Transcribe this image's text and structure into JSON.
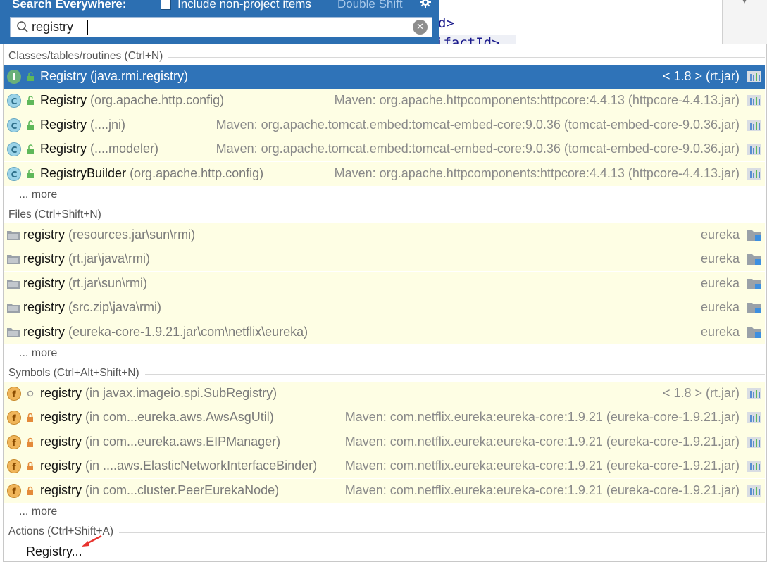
{
  "editor": {
    "code_line_1": "d>",
    "code_line_2": "ifactId>"
  },
  "header": {
    "title": "Search Everywhere:",
    "checkbox_label": "Include non-project items",
    "checkbox_shortcut": "Double Shift",
    "checkbox_checked": false,
    "settings_icon": "gear-icon"
  },
  "search": {
    "value": "registry",
    "search_icon": "search-icon",
    "clear_icon": "clear-icon"
  },
  "colors": {
    "header_bg": "#2c6fb2",
    "selected_row": "#2f73b8",
    "row_bg": "#fefee4"
  },
  "groups": {
    "classes": {
      "label": "Classes/tables/routines (Ctrl+N)",
      "items": [
        {
          "icon": "I",
          "name": "Registry",
          "context": "(java.rmi.registry)",
          "location": "< 1.8 > (rt.jar)"
        },
        {
          "icon": "C",
          "name": "Registry",
          "context": "(org.apache.http.config)",
          "location": "Maven: org.apache.httpcomponents:httpcore:4.4.13 (httpcore-4.4.13.jar)"
        },
        {
          "icon": "C",
          "name": "Registry",
          "context": "(....jni)",
          "location": "Maven: org.apache.tomcat.embed:tomcat-embed-core:9.0.36 (tomcat-embed-core-9.0.36.jar)"
        },
        {
          "icon": "C",
          "name": "Registry",
          "context": "(....modeler)",
          "location": "Maven: org.apache.tomcat.embed:tomcat-embed-core:9.0.36 (tomcat-embed-core-9.0.36.jar)"
        },
        {
          "icon": "C",
          "name": "RegistryBuilder",
          "context": "(org.apache.http.config)",
          "location": "Maven: org.apache.httpcomponents:httpcore:4.4.13 (httpcore-4.4.13.jar)"
        }
      ],
      "more": "... more"
    },
    "files": {
      "label": "Files (Ctrl+Shift+N)",
      "items": [
        {
          "name": "registry",
          "context": "(resources.jar\\sun\\rmi)",
          "location": "eureka"
        },
        {
          "name": "registry",
          "context": "(rt.jar\\java\\rmi)",
          "location": "eureka"
        },
        {
          "name": "registry",
          "context": "(rt.jar\\sun\\rmi)",
          "location": "eureka"
        },
        {
          "name": "registry",
          "context": "(src.zip\\java\\rmi)",
          "location": "eureka"
        },
        {
          "name": "registry",
          "context": "(eureka-core-1.9.21.jar\\com\\netflix\\eureka)",
          "location": "eureka"
        }
      ],
      "more": "... more"
    },
    "symbols": {
      "label": "Symbols (Ctrl+Alt+Shift+N)",
      "items": [
        {
          "icon": "f",
          "name": "registry",
          "context": "(in javax.imageio.spi.SubRegistry)",
          "location": "< 1.8 > (rt.jar)"
        },
        {
          "icon": "f",
          "name": "registry",
          "context": "(in com...eureka.aws.AwsAsgUtil)",
          "location": "Maven: com.netflix.eureka:eureka-core:1.9.21 (eureka-core-1.9.21.jar)"
        },
        {
          "icon": "f",
          "name": "registry",
          "context": "(in com...eureka.aws.EIPManager)",
          "location": "Maven: com.netflix.eureka:eureka-core:1.9.21 (eureka-core-1.9.21.jar)"
        },
        {
          "icon": "f",
          "name": "registry",
          "context": "(in ....aws.ElasticNetworkInterfaceBinder)",
          "location": "Maven: com.netflix.eureka:eureka-core:1.9.21 (eureka-core-1.9.21.jar)"
        },
        {
          "icon": "f",
          "name": "registry",
          "context": "(in com...cluster.PeerEurekaNode)",
          "location": "Maven: com.netflix.eureka:eureka-core:1.9.21 (eureka-core-1.9.21.jar)"
        }
      ],
      "more": "... more"
    },
    "actions": {
      "label": "Actions (Ctrl+Shift+A)",
      "items": [
        {
          "name": "Registry..."
        }
      ]
    }
  }
}
